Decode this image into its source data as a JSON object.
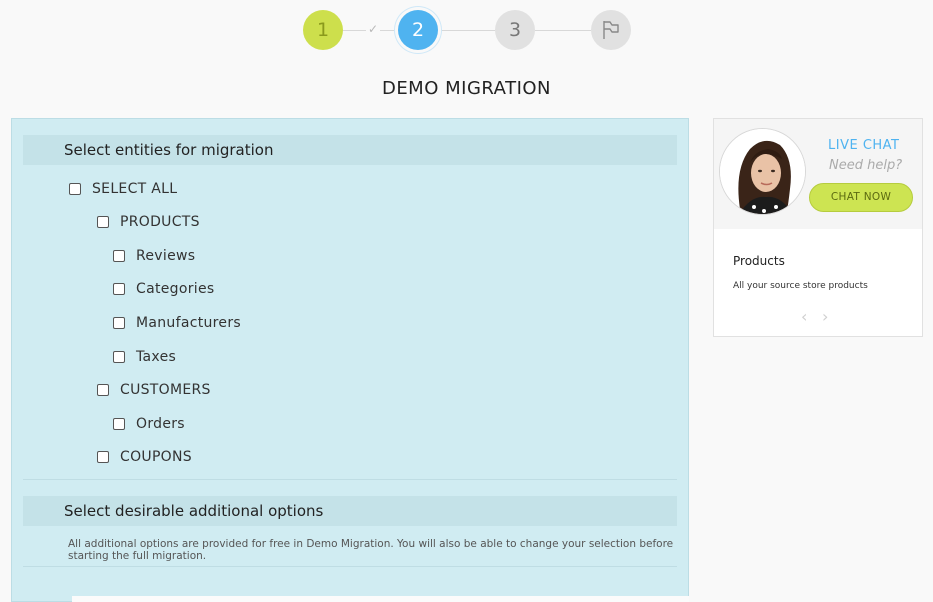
{
  "stepper": {
    "steps": [
      {
        "label": "1",
        "state": "done"
      },
      {
        "label": "2",
        "state": "active"
      },
      {
        "label": "3",
        "state": "pending"
      },
      {
        "label": "",
        "state": "pending",
        "icon": "flag-icon"
      }
    ],
    "colors": {
      "done": "#cddf4c",
      "active": "#4fb3f0",
      "pending": "#e1e1e1"
    }
  },
  "page": {
    "title": "DEMO MIGRATION"
  },
  "entities": {
    "header": "Select entities for migration",
    "items": {
      "select_all": "SELECT ALL",
      "products": "PRODUCTS",
      "reviews": "Reviews",
      "categories": "Categories",
      "manufacturers": "Manufacturers",
      "taxes": "Taxes",
      "customers": "CUSTOMERS",
      "orders": "Orders",
      "coupons": "COUPONS"
    }
  },
  "additional": {
    "header": "Select desirable additional options",
    "note": "All additional options are provided for free in Demo Migration. You will also be able to change your selection before starting the full migration."
  },
  "chat": {
    "title": "LIVE CHAT",
    "subtitle": "Need help?",
    "button": "CHAT NOW"
  },
  "slider": {
    "title": "Products",
    "description": "All your source store products"
  }
}
